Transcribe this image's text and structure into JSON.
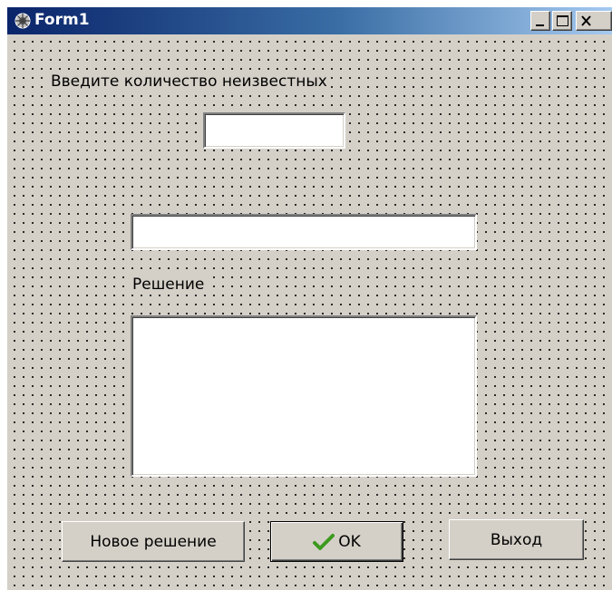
{
  "window": {
    "title": "Form1",
    "icon": "delphi-app-icon"
  },
  "controls": {
    "minimize_icon": "minimize-icon",
    "maximize_icon": "maximize-icon",
    "close_icon": "close-icon"
  },
  "form": {
    "count_label": "Введите количество неизвестных",
    "count_value": "",
    "equation_value": "",
    "solution_label": "Решение",
    "solution_value": ""
  },
  "buttons": {
    "new_solution": "Новое решение",
    "ok": "OK",
    "ok_icon": "checkmark-icon",
    "exit": "Выход"
  },
  "colors": {
    "titlebar_start": "#0a246a",
    "titlebar_end": "#a6caf0",
    "face": "#d4d0c8",
    "checkmark": "#3c9a1e"
  }
}
